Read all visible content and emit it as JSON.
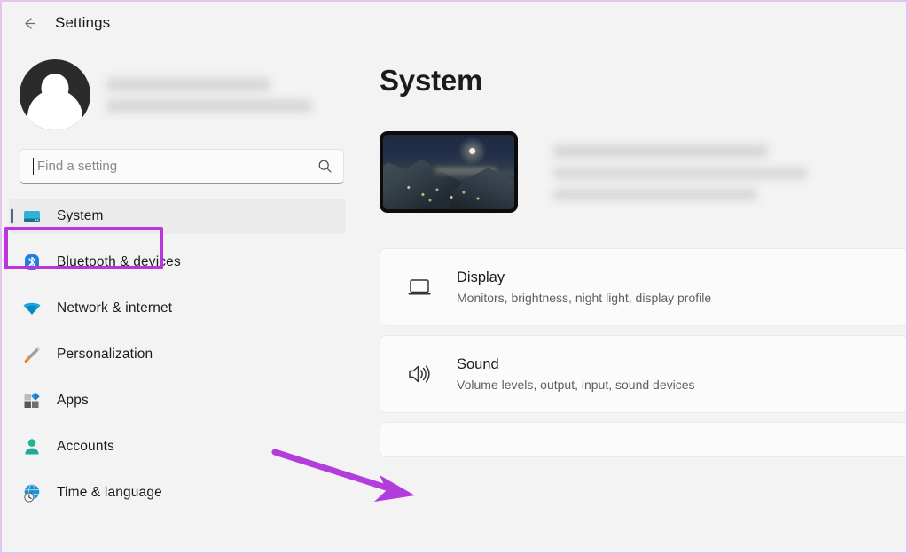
{
  "window": {
    "title": "Settings",
    "back_icon": "back-arrow-icon"
  },
  "sidebar": {
    "account": {
      "avatar_icon": "user-avatar-icon",
      "name_redacted": "",
      "email_redacted": ""
    },
    "search": {
      "placeholder": "Find a setting",
      "value": "",
      "icon": "search-icon"
    },
    "items": [
      {
        "label": "System",
        "icon": "monitor-icon",
        "selected": true
      },
      {
        "label": "Bluetooth & devices",
        "icon": "bluetooth-icon",
        "selected": false
      },
      {
        "label": "Network & internet",
        "icon": "wifi-icon",
        "selected": false
      },
      {
        "label": "Personalization",
        "icon": "paintbrush-icon",
        "selected": false
      },
      {
        "label": "Apps",
        "icon": "apps-icon",
        "selected": false
      },
      {
        "label": "Accounts",
        "icon": "person-icon",
        "selected": false
      },
      {
        "label": "Time & language",
        "icon": "globe-clock-icon",
        "selected": false
      }
    ]
  },
  "main": {
    "page_title": "System",
    "device": {
      "thumbnail_icon": "device-wallpaper-thumbnail",
      "name_redacted": "",
      "model_redacted": "",
      "rename_redacted": ""
    },
    "cards": [
      {
        "title": "Display",
        "subtitle": "Monitors, brightness, night light, display profile",
        "icon": "monitor-outline-icon"
      },
      {
        "title": "Sound",
        "subtitle": "Volume levels, output, input, sound devices",
        "icon": "speaker-icon"
      }
    ]
  },
  "annotations": {
    "highlight_color": "#bb35dd",
    "arrow_color": "#b23cdc",
    "frame_color": "#e3c4ee",
    "highlight_target": "System",
    "arrow_target": "Sound"
  }
}
